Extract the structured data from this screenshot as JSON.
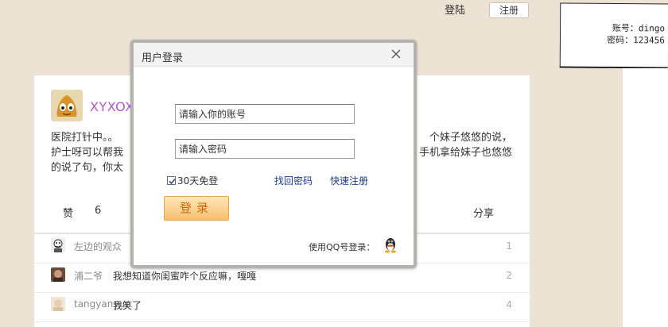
{
  "topbar": {
    "login_label": "登陆",
    "register_label": "注册"
  },
  "note": {
    "account_line": "账号：dingo",
    "password_line": "密码：123456"
  },
  "post": {
    "username": "XYXOX",
    "text_lines": [
      {
        "left": "医院打针中。。",
        "right": "个妹子悠悠的说，"
      },
      {
        "left": "护士呀可以帮我",
        "right": "手机拿给妹子也悠悠"
      },
      {
        "left": "的说了句，你太",
        "right": ""
      }
    ],
    "like_label": "赞",
    "like_count": "6",
    "share_label": "分享"
  },
  "comments": [
    {
      "name": "左边的观众",
      "text": "",
      "index": "1"
    },
    {
      "name": "浦二爷",
      "text": "我想知道你闺蜜咋个反应嘛，嘎嘎",
      "index": "2"
    },
    {
      "name": "tangyanyun",
      "text": "我笑了",
      "index": "4"
    }
  ],
  "modal": {
    "title": "用户登录",
    "account_placeholder": "请输入你的账号",
    "password_placeholder": "请输入密码",
    "remember_label": "30天免登",
    "forgot_label": "找回密码",
    "quick_register_label": "快速注册",
    "login_button_label": "登录",
    "qq_login_label": "使用QQ号登录："
  },
  "colors": {
    "background": "#ece3d5",
    "username": "#b45bd0",
    "link": "#1b3a8a",
    "button_text": "#c86a10"
  },
  "icons": {
    "close": "close-icon",
    "qq": "qq-penguin-icon",
    "check": "check-icon"
  }
}
